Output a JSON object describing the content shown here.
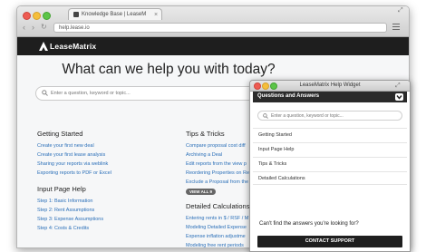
{
  "browser": {
    "tab_title": "Knowledge Base | LeaseM",
    "address": "help.lease.io"
  },
  "site": {
    "logo_text": "LeaseMatrix",
    "hero_title": "What can we help you with today?",
    "search_placeholder": "Enter a question, keyword or topic...",
    "sections": [
      {
        "title": "Getting Started",
        "links": [
          "Create your first new deal",
          "Create your first lease analysis",
          "Sharing your reports via weblink",
          "Exporting reports to PDF or Excel"
        ]
      },
      {
        "title": "Input Page Help",
        "links": [
          "Step 1: Basic Information",
          "Step 2: Rent Assumptions",
          "Step 3: Expense Assumptions",
          "Step 4: Costs & Credits"
        ]
      },
      {
        "title": "Tips & Tricks",
        "links": [
          "Compare proposal cost diff",
          "Archiving a Deal",
          "Edit reports from the view p",
          "Reordering Properties on Re",
          "Exclude a Proposal from the"
        ],
        "view_all": "VIEW ALL 9"
      },
      {
        "title": "Detailed Calculations",
        "links": [
          "Entering rents in $ / RSF / M",
          "Modeling Detailed Expense",
          "Expense inflation adjustme",
          "Modeling free rent periods"
        ]
      }
    ]
  },
  "widget": {
    "window_title": "LeaseMatrix Help Widget",
    "header": "Questions and Answers",
    "search_placeholder": "Enter a question, keyword or topic...",
    "items": [
      "Getting Started",
      "Input Page Help",
      "Tips & Tricks",
      "Detailed Calculations"
    ],
    "cta_text": "Can't find the answers you're looking for?",
    "contact_label": "CONTACT SUPPORT"
  },
  "colors": {
    "link": "#2a6fb8",
    "header_bg": "#1e1e1e",
    "widget_header_bg": "#2a2a2a"
  }
}
